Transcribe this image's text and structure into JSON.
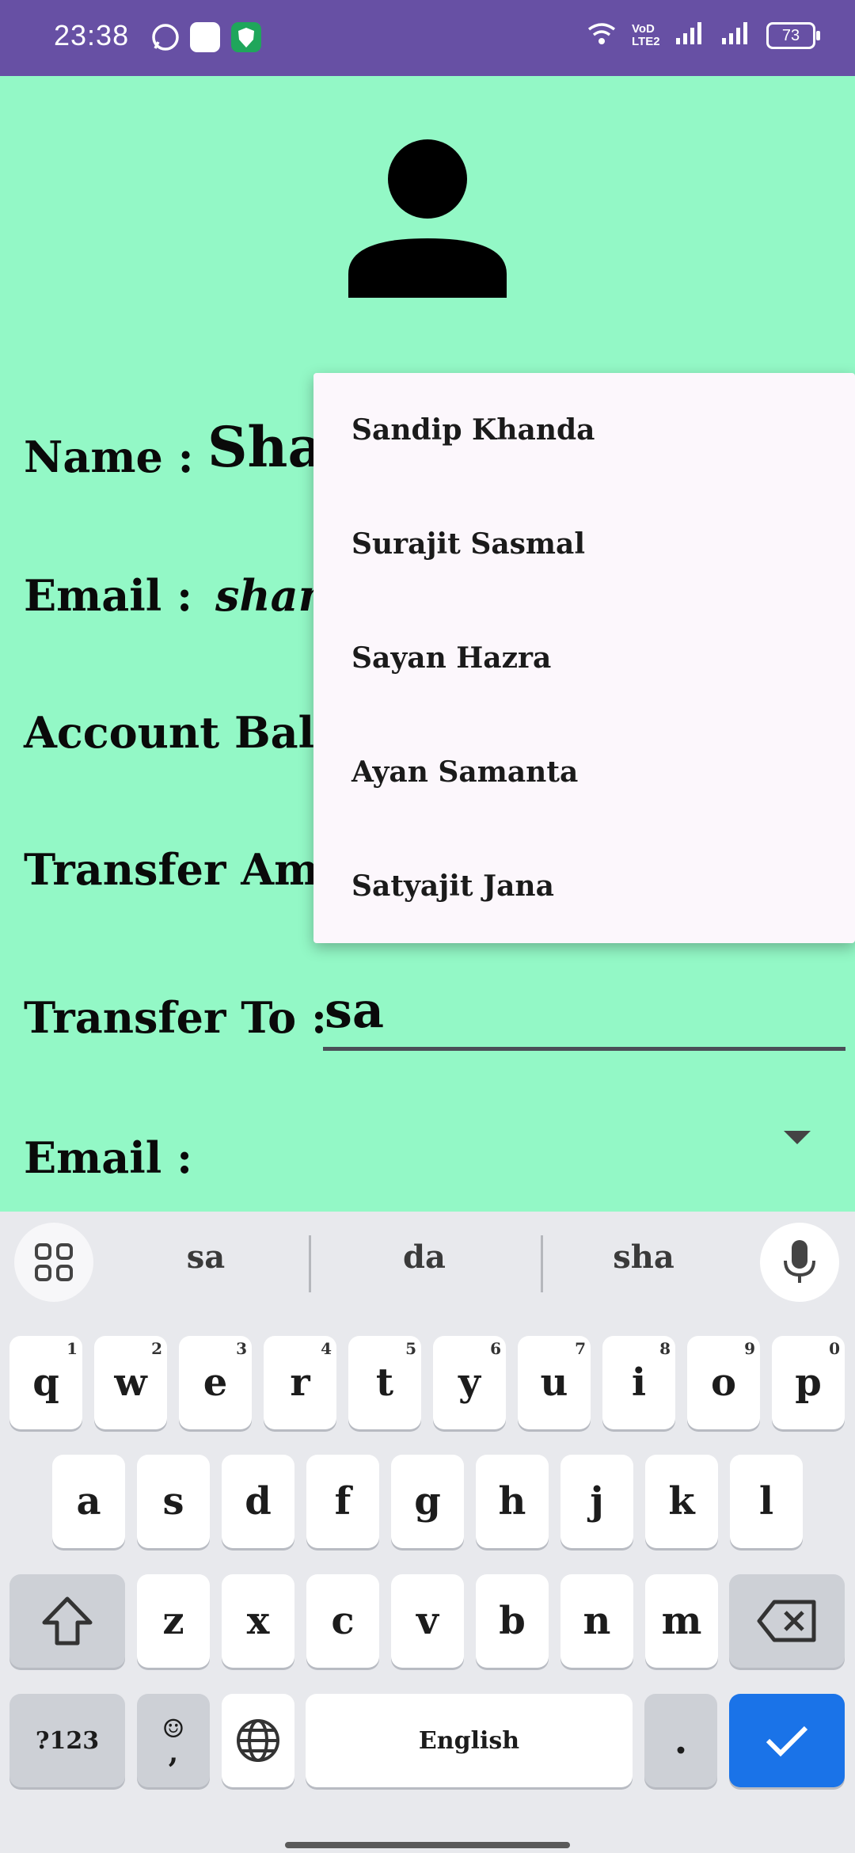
{
  "status_bar": {
    "time": "23:38",
    "network_label": "VoD LTE2",
    "battery": "73",
    "app_icons": [
      "whatsapp-icon",
      "zomato-icon",
      "shield-app-icon"
    ]
  },
  "profile": {
    "avatar_icon": "person-icon",
    "name_label": "Name :",
    "name_value": "Shan",
    "email_label": "Email :",
    "email_value": "shan",
    "balance_label": "Account Ballan",
    "transfer_amount_label": "Transfer Amn",
    "transfer_to_label": "Transfer To :",
    "transfer_to_value": "sa",
    "email2_label": "Email :"
  },
  "autocomplete": {
    "items": [
      "Sandip Khanda",
      "Surajit Sasmal",
      "Sayan Hazra",
      "Ayan Samanta",
      "Satyajit Jana"
    ]
  },
  "keyboard": {
    "suggestions": [
      "sa",
      "da",
      "sha"
    ],
    "row1": [
      {
        "k": "q",
        "h": "1"
      },
      {
        "k": "w",
        "h": "2"
      },
      {
        "k": "e",
        "h": "3"
      },
      {
        "k": "r",
        "h": "4"
      },
      {
        "k": "t",
        "h": "5"
      },
      {
        "k": "y",
        "h": "6"
      },
      {
        "k": "u",
        "h": "7"
      },
      {
        "k": "i",
        "h": "8"
      },
      {
        "k": "o",
        "h": "9"
      },
      {
        "k": "p",
        "h": "0"
      }
    ],
    "row2": [
      "a",
      "s",
      "d",
      "f",
      "g",
      "h",
      "j",
      "k",
      "l"
    ],
    "row3": [
      "z",
      "x",
      "c",
      "v",
      "b",
      "n",
      "m"
    ],
    "symbols_label": "?123",
    "comma_label": ",",
    "space_label": "English",
    "period_label": ".",
    "colors": {
      "accent": "#1a73e8",
      "background": "#e8e9ed"
    }
  },
  "colors": {
    "status_bar": "#6750a4",
    "page_background": "#93f8c6",
    "popup_background": "#fcf7fc"
  }
}
